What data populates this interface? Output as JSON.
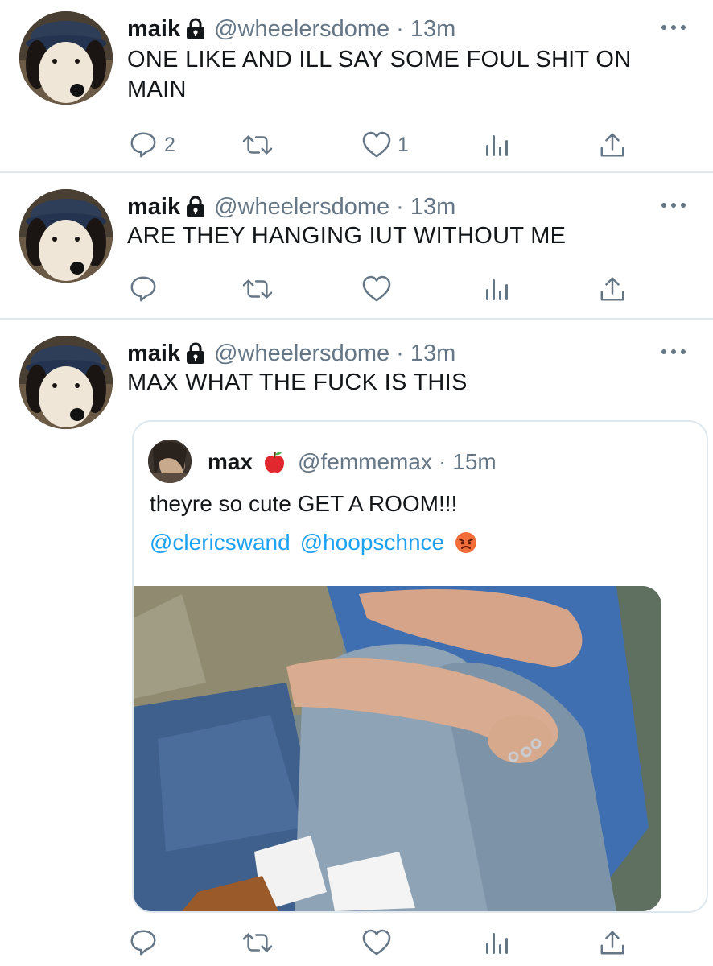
{
  "tweets": [
    {
      "name": "maik",
      "handle": "@wheelersdome",
      "time": "13m",
      "dot": "·",
      "text": "ONE LIKE AND ILL SAY SOME FOUL SHIT ON MAIN",
      "replies": "2",
      "retweets": "",
      "likes": "1"
    },
    {
      "name": "maik",
      "handle": "@wheelersdome",
      "time": "13m",
      "dot": "·",
      "text": "ARE THEY HANGING IUT WITHOUT ME",
      "replies": "",
      "retweets": "",
      "likes": ""
    },
    {
      "name": "maik",
      "handle": "@wheelersdome",
      "time": "13m",
      "dot": "·",
      "text": "MAX WHAT THE FUCK IS THIS",
      "replies": "",
      "retweets": "",
      "likes": ""
    }
  ],
  "quote": {
    "name": "max",
    "handle": "@femmemax",
    "time": "15m",
    "dot": "·",
    "body": "theyre so cute GET A ROOM!!!",
    "mentions": [
      "@clericswand",
      "@hoopschnce"
    ],
    "emoji": "angry-face",
    "name_emoji": "red-apple"
  },
  "icons": {
    "reply": "reply-icon",
    "retweet": "retweet-icon",
    "like": "heart-icon",
    "analytics": "analytics-icon",
    "share": "share-icon",
    "more": "more-icon",
    "lock": "lock-icon"
  },
  "colors": {
    "text": "#14171a",
    "secondary": "#657786",
    "link": "#1da1f2",
    "divider": "#e1e8ed"
  }
}
